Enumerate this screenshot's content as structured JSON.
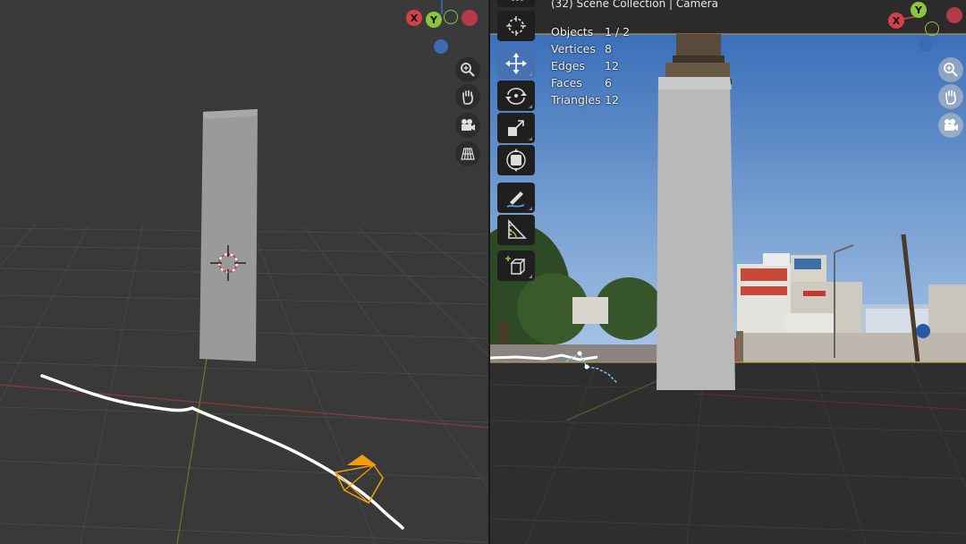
{
  "right_viewport": {
    "header_text": "(32) Scene Collection | Camera",
    "stats": [
      {
        "label": "Objects",
        "value": "1 / 2"
      },
      {
        "label": "Vertices",
        "value": "8"
      },
      {
        "label": "Edges",
        "value": "12"
      },
      {
        "label": "Faces",
        "value": "6"
      },
      {
        "label": "Triangles",
        "value": "12"
      }
    ]
  },
  "gizmo": {
    "x_label": "X",
    "y_label": "Y"
  },
  "toolbar_tools": [
    "cursor-tool",
    "move-tool",
    "rotate-tool",
    "scale-tool",
    "transform-tool",
    "annotate-tool",
    "measure-tool",
    "add-cube-tool"
  ],
  "nav_icons": [
    "zoom-icon",
    "hand-pan-icon",
    "camera-view-icon",
    "perspective-grid-icon"
  ],
  "colors": {
    "x_axis": "#d2414a",
    "y_axis": "#8ac53d",
    "z_axis": "#3c6bb3",
    "active_tool": "#4672b4",
    "camera_orange": "#f39c12",
    "track_white": "#ffffff"
  }
}
